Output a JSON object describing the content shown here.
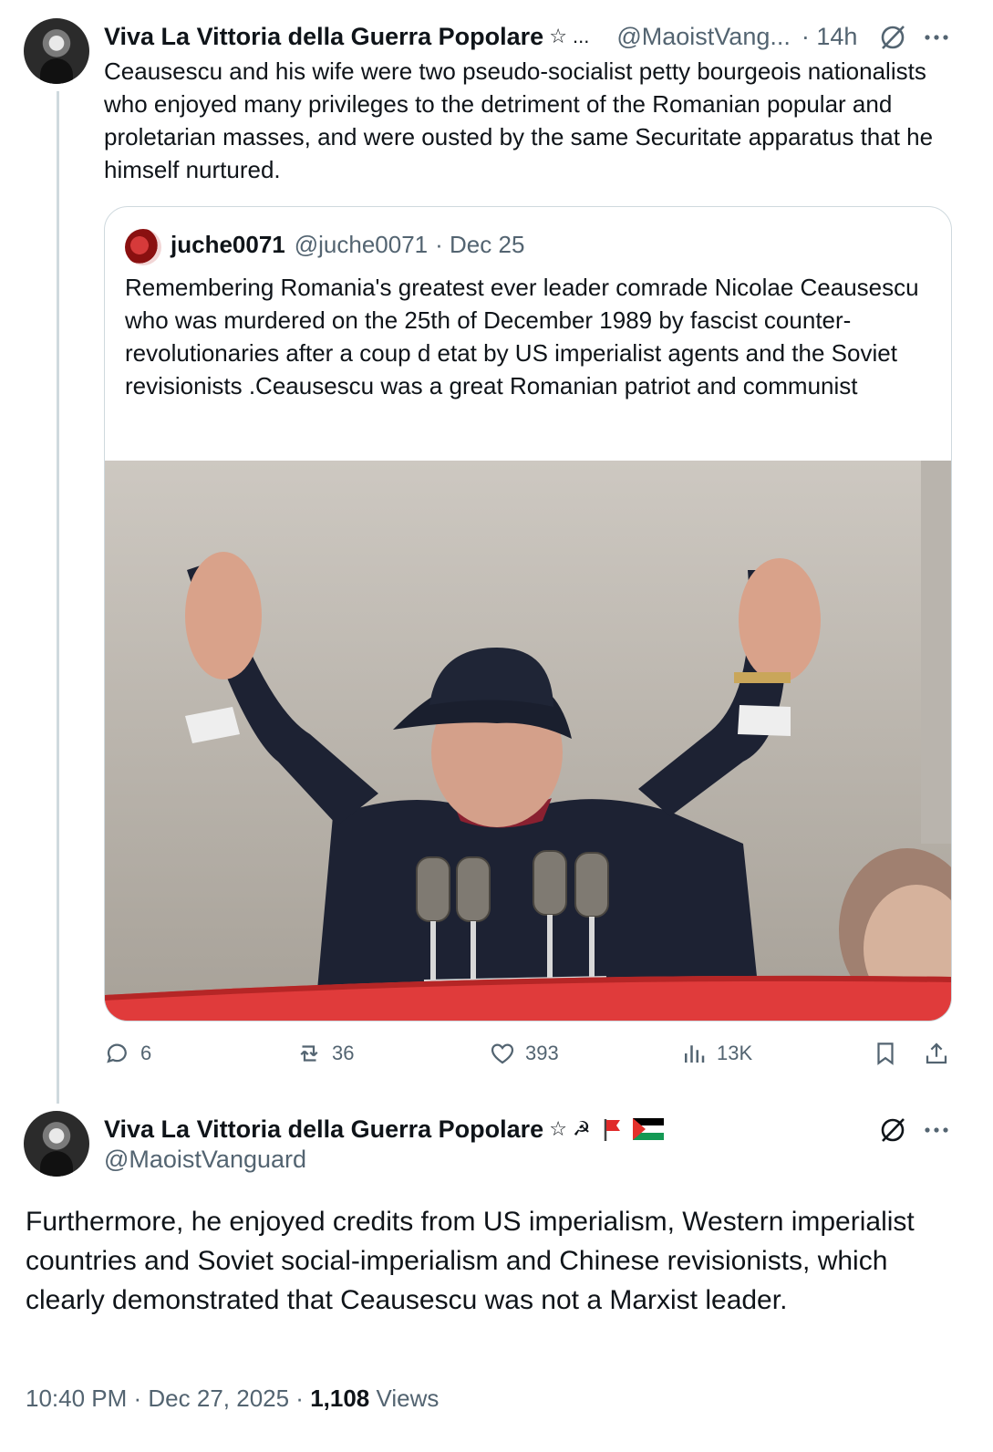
{
  "tweet1": {
    "display_name": "Viva La Vittoria della Guerra Popolare",
    "name_suffix": "☆ ...",
    "handle": "@MaoistVang...",
    "time": "· 14h",
    "text": "Ceausescu and his wife were two  pseudo-socialist petty bourgeois nationalists who enjoyed many privileges to the detriment of the Romanian popular and proletarian masses, and were ousted by the same Securitate apparatus that he himself nurtured.",
    "quote": {
      "display_name": "juche0071",
      "handle": "@juche0071",
      "date": "· Dec 25",
      "text": "Remembering Romania's greatest ever leader comrade Nicolae Ceausescu who was murdered on the 25th of December 1989 by fascist counter-revolutionaries after a coup d etat by US imperialist agents and the Soviet revisionists .Ceausescu was a great Romanian patriot and communist"
    },
    "actions": {
      "replies": "6",
      "reposts": "36",
      "likes": "393",
      "views": "13K"
    }
  },
  "tweet2": {
    "display_name": "Viva La Vittoria della Guerra Popolare",
    "name_suffix": "☆ ☭",
    "handle": "@MaoistVanguard",
    "text": "Furthermore, he enjoyed credits from US imperialism, Western imperialist countries and Soviet social-imperialism and Chinese revisionists, which clearly demonstrated that Ceausescu was not a Marxist leader.",
    "meta": {
      "time": "10:40 PM",
      "sep1": " · ",
      "date": "Dec 27, 2025",
      "sep2": " · ",
      "views_count": "1,108",
      "views_label": " Views"
    }
  },
  "colors": {
    "text_primary": "#0f1419",
    "text_secondary": "#536471",
    "border": "#cfd9de",
    "photo_banner_red": "#e03b3b"
  }
}
